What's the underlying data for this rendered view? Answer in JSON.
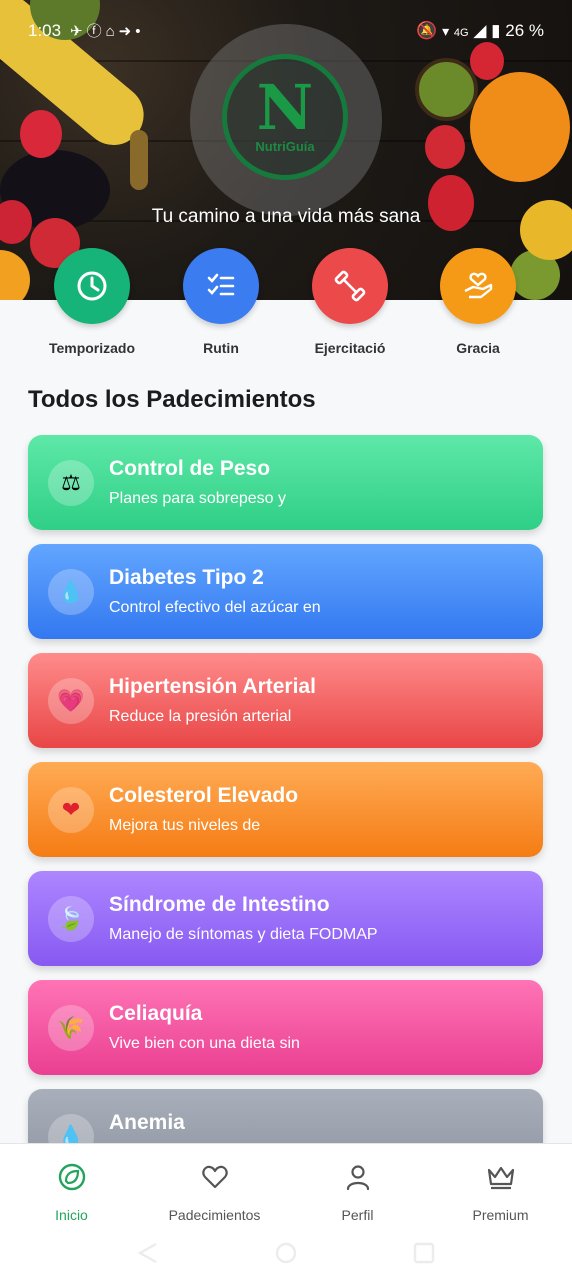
{
  "status_bar": {
    "time": "1:03",
    "battery": "26 %",
    "network": "4G"
  },
  "header": {
    "logo_text": "NutriGuía",
    "tagline": "Tu camino a una vida más sana"
  },
  "quick_actions": [
    {
      "label": "Temporizado",
      "icon": "clock-icon",
      "color": "#17b47a"
    },
    {
      "label": "Rutin",
      "icon": "checklist-icon",
      "color": "#3b7cf0"
    },
    {
      "label": "Ejercitació",
      "icon": "dumbbell-icon",
      "color": "#ec4a4a"
    },
    {
      "label": "Gracia",
      "icon": "heart-hand-icon",
      "color": "#f59a16"
    }
  ],
  "section": {
    "title": "Todos los Padecimientos"
  },
  "conditions": [
    {
      "title": "Control de Peso",
      "subtitle": "Planes para sobrepeso y",
      "icon": "scale-icon",
      "color_from": "#5ee8a8",
      "color_to": "#2fcf86"
    },
    {
      "title": "Diabetes Tipo 2",
      "subtitle": "Control efectivo del azúcar en",
      "icon": "blood-drop-icon",
      "color_from": "#62a6ff",
      "color_to": "#3378f0"
    },
    {
      "title": "Hipertensión Arterial",
      "subtitle": "Reduce la presión arterial",
      "icon": "heart-pulse-icon",
      "color_from": "#ff8b8b",
      "color_to": "#e94646"
    },
    {
      "title": "Colesterol Elevado",
      "subtitle": "Mejora tus niveles de",
      "icon": "heart-icon",
      "color_from": "#ffab55",
      "color_to": "#f57c14"
    },
    {
      "title": "Síndrome de Intestino",
      "subtitle": "Manejo de síntomas y dieta FODMAP",
      "icon": "leaf-icon",
      "color_from": "#ad86ff",
      "color_to": "#8759f2"
    },
    {
      "title": "Celiaquía",
      "subtitle": "Vive bien con una dieta sin",
      "icon": "wheat-icon",
      "color_from": "#ff74b5",
      "color_to": "#ea3f92"
    },
    {
      "title": "Anemia",
      "subtitle": "",
      "icon": "blood-drop-icon",
      "color_from": "#a9afba",
      "color_to": "#8b929f"
    }
  ],
  "bottom_nav": [
    {
      "label": "Inicio",
      "icon": "home-leaf-icon",
      "active": true
    },
    {
      "label": "Padecimientos",
      "icon": "heart-outline-icon",
      "active": false
    },
    {
      "label": "Perfil",
      "icon": "person-icon",
      "active": false
    },
    {
      "label": "Premium",
      "icon": "crown-icon",
      "active": false
    }
  ]
}
